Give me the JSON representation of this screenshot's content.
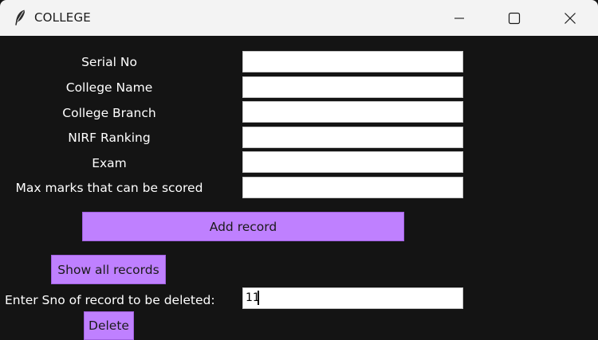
{
  "window": {
    "title": "COLLEGE"
  },
  "icons": {
    "app": "feather-icon",
    "minimize": "minimize-icon",
    "maximize": "maximize-icon",
    "close": "close-icon"
  },
  "form": {
    "fields": [
      {
        "label": "Serial No",
        "value": ""
      },
      {
        "label": "College Name",
        "value": ""
      },
      {
        "label": "College Branch",
        "value": ""
      },
      {
        "label": "NIRF Ranking",
        "value": ""
      },
      {
        "label": "Exam",
        "value": ""
      },
      {
        "label": "Max marks that can be scored",
        "value": ""
      }
    ],
    "add_label": "Add record",
    "show_all_label": "Show all records",
    "delete_prompt": "Enter Sno of record to be deleted:",
    "delete_value": "11",
    "delete_label": "Delete"
  },
  "colors": {
    "background": "#141414",
    "button": "#bf80ff",
    "titlebar": "#f3f3f3"
  }
}
